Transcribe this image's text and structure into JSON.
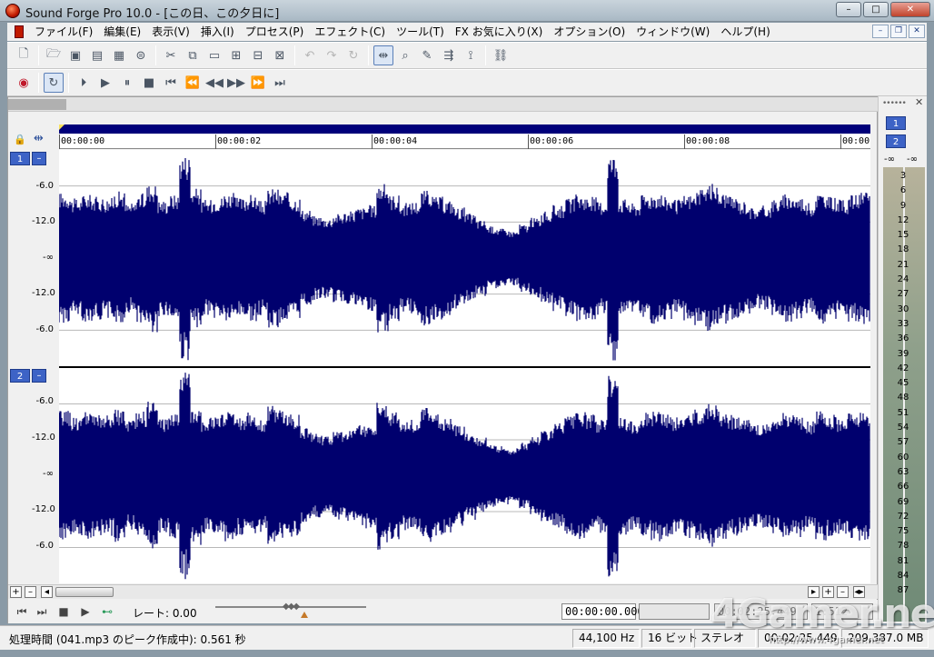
{
  "window": {
    "title": "Sound Forge Pro 10.0 - [この日、この夕日に]"
  },
  "window_buttons": {
    "minimize": "–",
    "maximize": "□",
    "close": "✕"
  },
  "menu": {
    "items": [
      "ファイル(F)",
      "編集(E)",
      "表示(V)",
      "挿入(I)",
      "プロセス(P)",
      "エフェクト(C)",
      "ツール(T)",
      "FX お気に入り(X)",
      "オプション(O)",
      "ウィンドウ(W)",
      "ヘルプ(H)"
    ],
    "mdi_minimize": "–",
    "mdi_restore": "❐",
    "mdi_close": "✕"
  },
  "ruler": {
    "labels": [
      "00:00:00",
      "00:00:02",
      "00:00:04",
      "00:00:06",
      "00:00:08",
      "00:00"
    ]
  },
  "channels": [
    {
      "number": "1",
      "minimize": "–",
      "db_labels": [
        "-6.0",
        "-12.0",
        "-∞",
        "-12.0",
        "-6.0"
      ]
    },
    {
      "number": "2",
      "minimize": "–",
      "db_labels": [
        "-6.0",
        "-12.0",
        "-∞",
        "-12.0",
        "-6.0"
      ]
    }
  ],
  "waveform": {
    "color": "#00006e",
    "peaks": [
      0.62,
      0.56,
      0.6,
      0.58,
      0.57,
      0.63,
      0.52,
      0.61,
      0.7,
      0.55,
      0.6,
      0.98,
      0.66,
      0.55,
      0.58,
      0.62,
      0.57,
      0.6,
      0.54,
      0.66,
      0.62,
      0.58,
      0.46,
      0.4,
      0.38,
      0.42,
      0.44,
      0.48,
      0.5,
      0.7,
      0.6,
      0.52,
      0.54,
      0.64,
      0.58,
      0.55,
      0.48,
      0.42,
      0.36,
      0.3,
      0.28,
      0.26,
      0.32,
      0.38,
      0.44,
      0.5,
      0.56,
      0.6,
      0.58,
      0.54,
      0.98,
      0.56,
      0.52,
      0.6,
      0.62,
      0.58,
      0.55,
      0.6,
      0.64,
      0.7,
      0.62,
      0.58,
      0.54,
      0.48,
      0.5,
      0.56,
      0.6,
      0.58,
      0.52,
      0.62,
      0.58,
      0.55,
      0.6,
      0.62
    ]
  },
  "scroll": {
    "plus": "+",
    "minus": "–",
    "left": "◂",
    "right": "▸",
    "zoom_plus": "+",
    "zoom_minus": "–",
    "zoom_lr": "◂▸"
  },
  "transport": {
    "rate_label": "レート: 0.00",
    "position": "00:00:00.000",
    "selection_end": "",
    "length_field": "00:02:25.449",
    "zoom_ratio": "1:512"
  },
  "meter": {
    "grip": "••••••",
    "close": "✕",
    "ch1": "1",
    "ch2": "2",
    "inf_left": "-∞",
    "inf_right": "-∞",
    "scale": [
      "3",
      "6",
      "9",
      "12",
      "15",
      "18",
      "21",
      "24",
      "27",
      "30",
      "33",
      "36",
      "39",
      "42",
      "45",
      "48",
      "51",
      "54",
      "57",
      "60",
      "63",
      "66",
      "69",
      "72",
      "75",
      "78",
      "81",
      "84",
      "87"
    ]
  },
  "status": {
    "text": "処理時間 (041.mp3 のピーク作成中): 0.561 秒",
    "sample_rate": "44,100 Hz",
    "bit_depth": "16 ビット",
    "channels": "ステレオ",
    "length": "00:02:25.449",
    "size": "209,387.0 MB"
  },
  "watermark": {
    "logo": "4Gamer.net",
    "url": "http://www.4gamer.net"
  }
}
